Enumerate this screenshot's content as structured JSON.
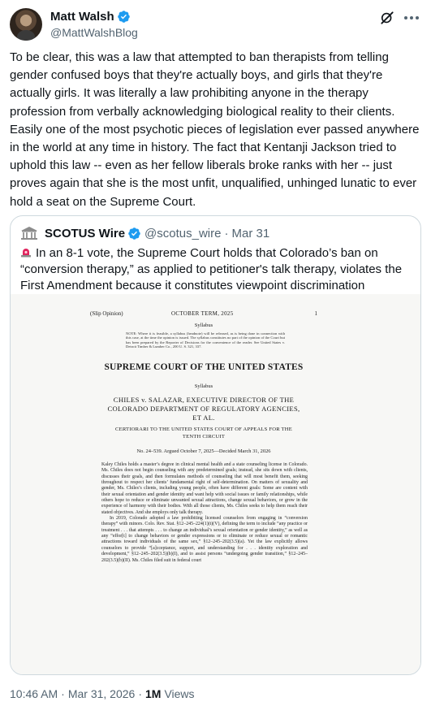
{
  "author": {
    "display_name": "Matt Walsh",
    "handle": "@MattWalshBlog",
    "verified_color": "#1d9bf0"
  },
  "header_actions": {
    "grok_icon": "grok-icon",
    "more_icon": "more-horizontal-icon"
  },
  "tweet": {
    "text": "To be clear, this was a law that attempted to ban therapists from telling gender confused boys that they're actually boys, and girls that they're actually girls. It was literally a law prohibiting anyone in the therapy profession from verbally acknowledging biological reality to their clients. Easily one of the most psychotic pieces of legislation ever passed anywhere in the world at any time in history. The fact that Kentanji Jackson tried to uphold this law -- even as her fellow liberals broke ranks with her -- just proves again that she is the most unfit, unqualified, unhinged lunatic to ever hold a seat on the Supreme Court."
  },
  "quote": {
    "display_name": "SCOTUS Wire",
    "handle": "@scotus_wire",
    "dot": "·",
    "date": "Mar 31",
    "text": "In an 8-1 vote, the Supreme Court holds that Colorado’s ban on “conversion therapy,” as applied to petitioner's talk therapy, violates the First Amendment because it constitutes viewpoint discrimination",
    "document": {
      "slip": "(Slip Opinion)",
      "term": "OCTOBER TERM, 2025",
      "page": "1",
      "syllabus": "Syllabus",
      "note": "NOTE: Where it is feasible, a syllabus (headnote) will be released, as is being done in connection with this case, at the time the opinion is issued. The syllabus constitutes no part of the opinion of the Court but has been prepared by the Reporter of Decisions for the convenience of the reader. See United States v. Detroit Timber & Lumber Co., 200 U. S. 321, 337.",
      "court": "SUPREME COURT OF THE UNITED STATES",
      "syllabus2": "Syllabus",
      "case": "CHILES v. SALAZAR, EXECUTIVE DIRECTOR OF THE COLORADO DEPARTMENT OF REGULATORY AGENCIES, ET AL.",
      "cert": "CERTIORARI TO THE UNITED STATES COURT OF APPEALS FOR THE TENTH CIRCUIT",
      "docket": "No. 24–539.   Argued October 7, 2025—Decided March 31, 2026",
      "para1": "Kaley Chiles holds a master’s degree in clinical mental health and a state counseling license in Colorado. Ms. Chiles does not begin counseling with any predetermined goals; instead, she sits down with clients, discusses their goals, and then formulates methods of counseling that will most benefit them, seeking throughout to respect her clients’ fundamental right of self-determination. On matters of sexuality and gender, Ms. Chiles’s clients, including young people, often have different goals: Some are content with their sexual orientation and gender identity and want help with social issues or family relationships, while others hope to reduce or eliminate unwanted sexual attractions, change sexual behaviors, or grow in the experience of harmony with their bodies. With all those clients, Ms. Chiles seeks to help them reach their stated objectives. And she employs only talk therapy.",
      "para2": "In 2019, Colorado adopted a law prohibiting licensed counselors from engaging in “conversion therapy” with minors. Colo. Rev. Stat. §12–245–224(1)(t)(V), defining the term to include “any practice or treatment . . . that attempts . . . to change an individual’s sexual orientation or gender identity,” as well as any “effor[t] to change behaviors or gender expressions or to eliminate or reduce sexual or romantic attractions toward individuals of the same sex,” §12–245–202(3.5)(a). Yet the law explicitly allows counselors to provide “[a]cceptance, support, and understanding for . . . identity exploration and development,” §12–245–202(3.5)(b)(I), and to assist persons “undergoing gender transition,” §12–245–202(3.5)(b)(II). Ms. Chiles filed suit in federal court"
    }
  },
  "footer": {
    "time": "10:46 AM",
    "sep": "·",
    "date": "Mar 31, 2026",
    "sep2": "·",
    "views_count": "1M",
    "views_label": "Views"
  }
}
